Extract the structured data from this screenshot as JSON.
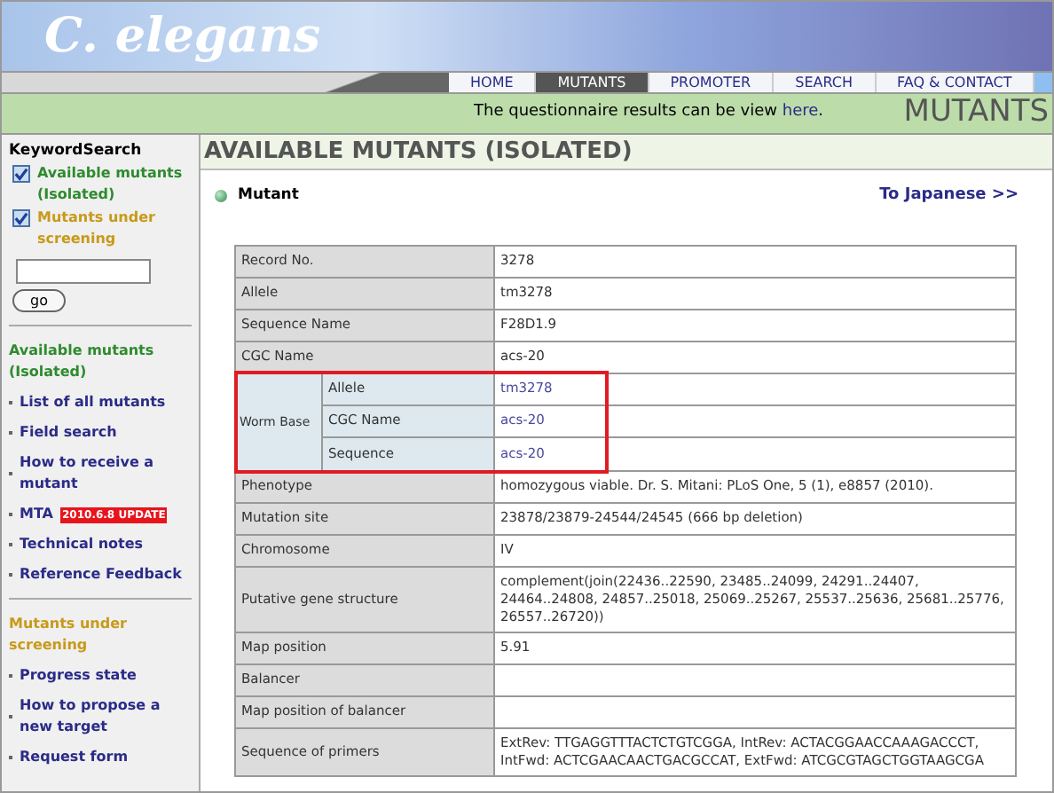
{
  "header": {
    "logo": "C. elegans"
  },
  "nav": {
    "tabs": [
      {
        "label": "HOME",
        "selected": false
      },
      {
        "label": "MUTANTS",
        "selected": true
      },
      {
        "label": "PROMOTER",
        "selected": false
      },
      {
        "label": "SEARCH",
        "selected": false
      },
      {
        "label": "FAQ & CONTACT",
        "selected": false
      }
    ]
  },
  "notice": {
    "text": "The questionnaire results can be view",
    "link": "here",
    "end": ".",
    "section": "MUTANTS"
  },
  "sidebar": {
    "search_title": "KeywordSearch",
    "filters": [
      {
        "label": "Available mutants (Isolated)",
        "checked": true,
        "color": "#2e8b2e"
      },
      {
        "label": "Mutants under screening",
        "checked": true,
        "color": "#c89a1a"
      }
    ],
    "search_field": {
      "button": "go"
    },
    "sections": [
      {
        "title": "Available mutants (Isolated)",
        "color": "#2e8b2e",
        "items": [
          {
            "label": "List of all mutants"
          },
          {
            "label": "Field search"
          },
          {
            "label": "How to receive a mutant"
          },
          {
            "label": "MTA",
            "badge": "2010.6.8 UPDATE"
          },
          {
            "label": "Technical notes"
          },
          {
            "label": "Reference Feedback"
          }
        ]
      },
      {
        "title": "Mutants under screening",
        "color": "#c89a1a",
        "items": [
          {
            "label": "Progress state"
          },
          {
            "label": "How to propose a new target"
          },
          {
            "label": "Request form"
          }
        ]
      }
    ]
  },
  "main": {
    "title": "AVAILABLE MUTANTS (ISOLATED)",
    "subtitle": "Mutant",
    "language_link": "To Japanese >>",
    "table": {
      "rows": [
        {
          "kind": "plain",
          "label": "Record No.",
          "value": "3278"
        },
        {
          "kind": "plain",
          "label": "Allele",
          "value": "tm3278"
        },
        {
          "kind": "plain",
          "label": "Sequence Name",
          "value": "F28D1.9"
        },
        {
          "kind": "plain",
          "label": "CGC Name",
          "value": "acs-20"
        },
        {
          "kind": "group",
          "label": "Worm Base",
          "highlighted": true,
          "children": [
            {
              "label": "Allele",
              "value": "tm3278"
            },
            {
              "label": "CGC Name",
              "value": "acs-20"
            },
            {
              "label": "Sequence",
              "value": "acs-20"
            }
          ]
        },
        {
          "kind": "plain",
          "label": "Phenotype",
          "value": "homozygous viable. Dr. S. Mitani: PLoS One, 5 (1), e8857 (2010)."
        },
        {
          "kind": "plain",
          "label": "Mutation site",
          "value": "23878/23879-24544/24545 (666 bp deletion)"
        },
        {
          "kind": "plain",
          "label": "Chromosome",
          "value": "IV"
        },
        {
          "kind": "plain",
          "label": "Putative gene structure",
          "value": "complement(join(22436..22590, 23485..24099, 24291..24407, 24464..24808, 24857..25018, 25069..25267, 25537..25636, 25681..25776, 26557..26720))"
        },
        {
          "kind": "plain",
          "label": "Map position",
          "value": "5.91"
        },
        {
          "kind": "plain",
          "label": "Balancer"
        },
        {
          "kind": "plain",
          "label": "Map position of balancer"
        },
        {
          "kind": "plain",
          "label": "Sequence of primers",
          "value": "ExtRev: TTGAGGTTTACTCTGTCGGA, IntRev: ACTACGGAACCAAAGACCCT, IntFwd: ACTCGAACAACTGACGCCAT, ExtFwd: ATCGCGTAGCTGGTAAGCGA"
        }
      ]
    }
  }
}
